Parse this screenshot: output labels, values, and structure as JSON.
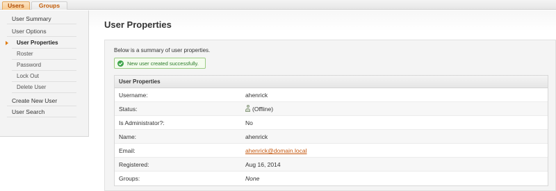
{
  "tabs": [
    {
      "label": "Users",
      "active": true
    },
    {
      "label": "Groups",
      "active": false
    }
  ],
  "sidebar": {
    "items": [
      {
        "label": "User Summary"
      },
      {
        "label": "User Options"
      },
      {
        "label": "User Properties",
        "selected": true
      },
      {
        "label": "Roster"
      },
      {
        "label": "Password"
      },
      {
        "label": "Lock Out"
      },
      {
        "label": "Delete User"
      },
      {
        "label": "Create New User"
      },
      {
        "label": "User Search"
      }
    ]
  },
  "main": {
    "title": "User Properties",
    "summary": "Below is a summary of user properties.",
    "success_message": "New user created successfully.",
    "success_icon": "check-circle-icon",
    "table": {
      "header": "User Properties",
      "rows": [
        {
          "label": "Username:",
          "value": "ahenrick"
        },
        {
          "label": "Status:",
          "value": "(Offline)",
          "icon": "user-offline-icon"
        },
        {
          "label": "Is Administrator?:",
          "value": "No"
        },
        {
          "label": "Name:",
          "value": "ahenrick"
        },
        {
          "label": "Email:",
          "value": "ahenrick@domain.local"
        },
        {
          "label": "Registered:",
          "value": "Aug 16, 2014"
        },
        {
          "label": "Groups:",
          "value": "None"
        }
      ]
    }
  },
  "colors": {
    "accent": "#c25b05",
    "link": "#c4570e",
    "success": "#3ea44a"
  }
}
